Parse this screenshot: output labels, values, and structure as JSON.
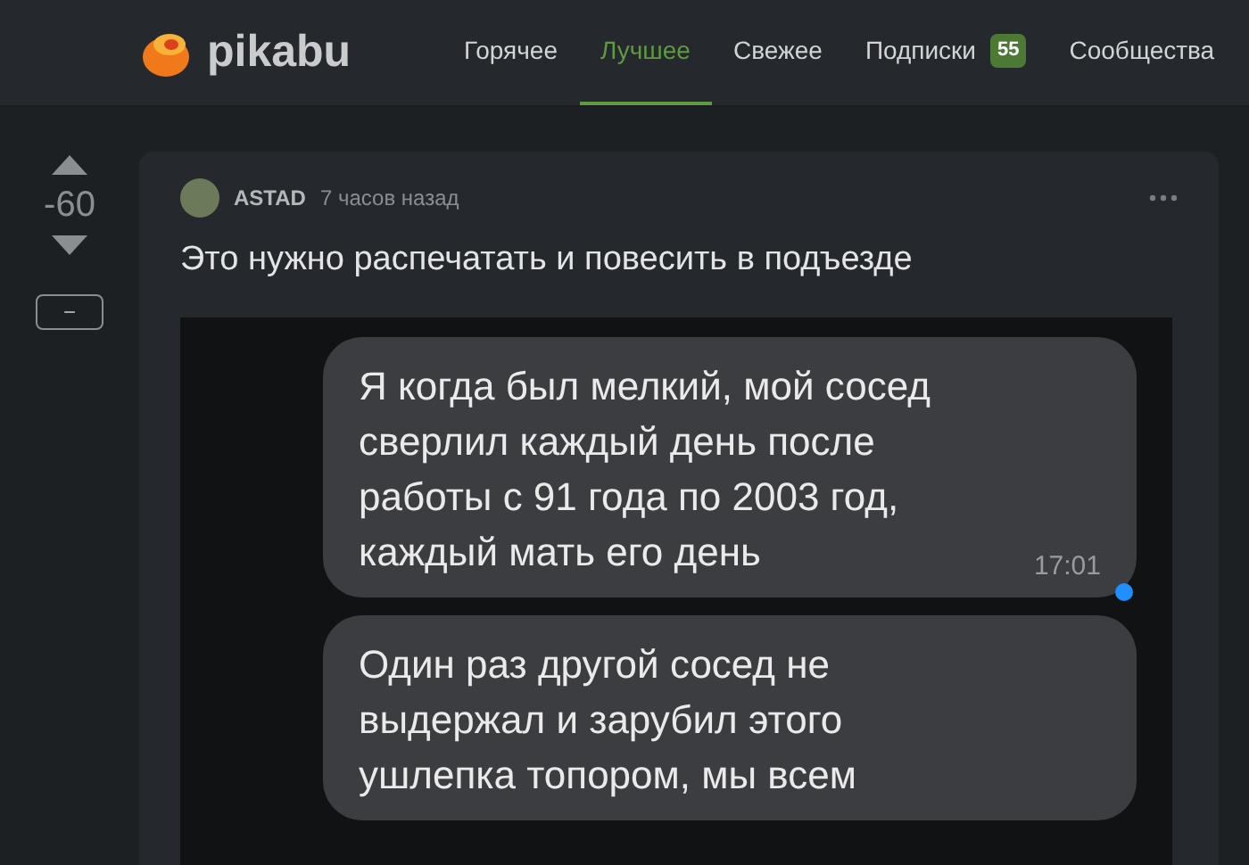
{
  "header": {
    "logo_text": "pikabu",
    "nav": [
      {
        "label": "Горячее",
        "selected": false
      },
      {
        "label": "Лучшее",
        "selected": true
      },
      {
        "label": "Свежее",
        "selected": false
      },
      {
        "label": "Подписки",
        "selected": false,
        "badge": "55"
      },
      {
        "label": "Сообщества",
        "selected": false
      }
    ]
  },
  "votes": {
    "score": "-60",
    "collapse": "−"
  },
  "post": {
    "author": "ASTAD",
    "time": "7 часов назад",
    "title": "Это нужно распечатать и повесить в подъезде",
    "chat": [
      {
        "text": "Я когда был мелкий, мой сосед сверлил каждый день после работы с 91 года по 2003 год, каждый мать его день",
        "time": "17:01",
        "unread": true
      },
      {
        "text": "Один раз другой сосед не выдержал и зарубил этого ушлепка топором, мы всем",
        "unread": false
      }
    ]
  }
}
